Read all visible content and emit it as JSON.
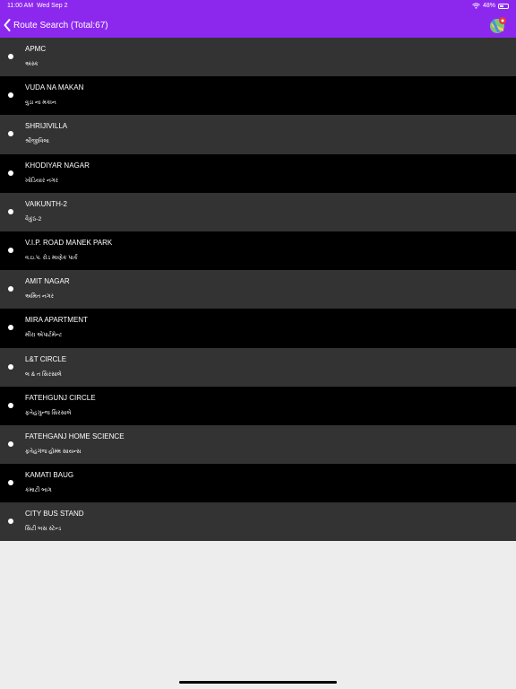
{
  "status_bar": {
    "time": "11:00 AM",
    "date": "Wed Sep 2",
    "battery": "48%",
    "battery_level": 0.48
  },
  "nav": {
    "title": "Route Search (Total:67)",
    "back_icon": "chevron-left-icon",
    "map_icon": "map-icon"
  },
  "colors": {
    "accent": "#8c28ee",
    "row_dark": "#000000",
    "row_alt": "#333333",
    "text": "#ffffff",
    "background": "#ededed"
  },
  "stops": [
    {
      "name": "APMC",
      "local": "અંસ્ક"
    },
    {
      "name": "VUDA NA MAKAN",
      "local": "વુડા ના મકાન"
    },
    {
      "name": "SHRIJIVILLA",
      "local": "શ્રીજીવિલા"
    },
    {
      "name": "KHODIYAR NAGAR",
      "local": "ખોડિયાર નગર"
    },
    {
      "name": "VAIKUNTH-2",
      "local": "વૈકુંઠ-2"
    },
    {
      "name": "V.I.P. ROAD MANEK PARK",
      "local": "વ.ઇ.પ. રોડ માણેક પાર્ક"
    },
    {
      "name": "AMIT NAGAR",
      "local": "અમિત નગર"
    },
    {
      "name": "MIRA APARTMENT",
      "local": "મીરા એપાર્ટમેન્ટ"
    },
    {
      "name": "L&T CIRCLE",
      "local": "લ & ત સિરસાલે"
    },
    {
      "name": "FATEHGUNJ CIRCLE",
      "local": "ફતેહગુન્જ સિરસાલે"
    },
    {
      "name": "FATEHGANJ HOME SCIENCE",
      "local": "ફતેહગંજ હોમ્મ સાયન્સ"
    },
    {
      "name": "KAMATI BAUG",
      "local": "કમાટી બાગ"
    },
    {
      "name": "CITY BUS STAND",
      "local": "સિટી બસ સ્ટેન્ડ"
    }
  ]
}
